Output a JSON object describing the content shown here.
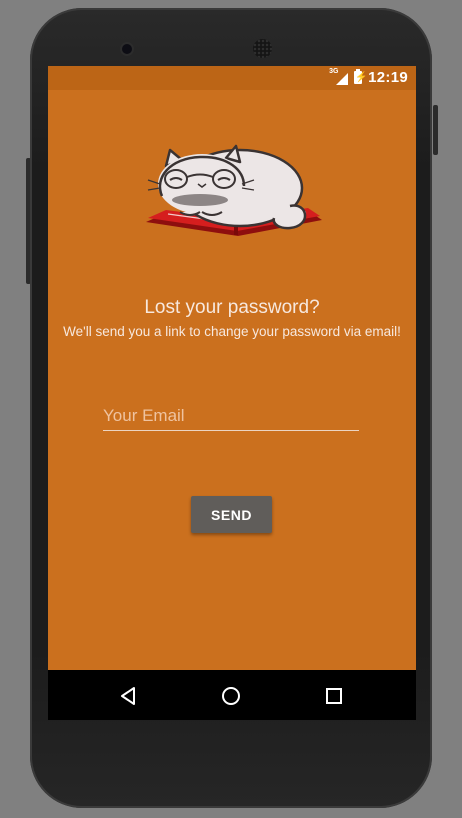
{
  "status_bar": {
    "network": "3G",
    "time": "12:19"
  },
  "logo": {
    "icon": "cat-with-glasses-on-book"
  },
  "page": {
    "title": "Lost your password?",
    "subtitle": "We'll send you a link to change your password via email!"
  },
  "form": {
    "email_placeholder": "Your Email",
    "email_value": "",
    "send_label": "SEND"
  },
  "nav_bar": {
    "back_icon": "back-triangle-icon",
    "home_icon": "home-circle-icon",
    "recent_icon": "recent-apps-square-icon"
  },
  "colors": {
    "background": "#CB701E",
    "status_bar": "#BC6516",
    "button": "#605D5A",
    "text": "#F7E8DE"
  }
}
